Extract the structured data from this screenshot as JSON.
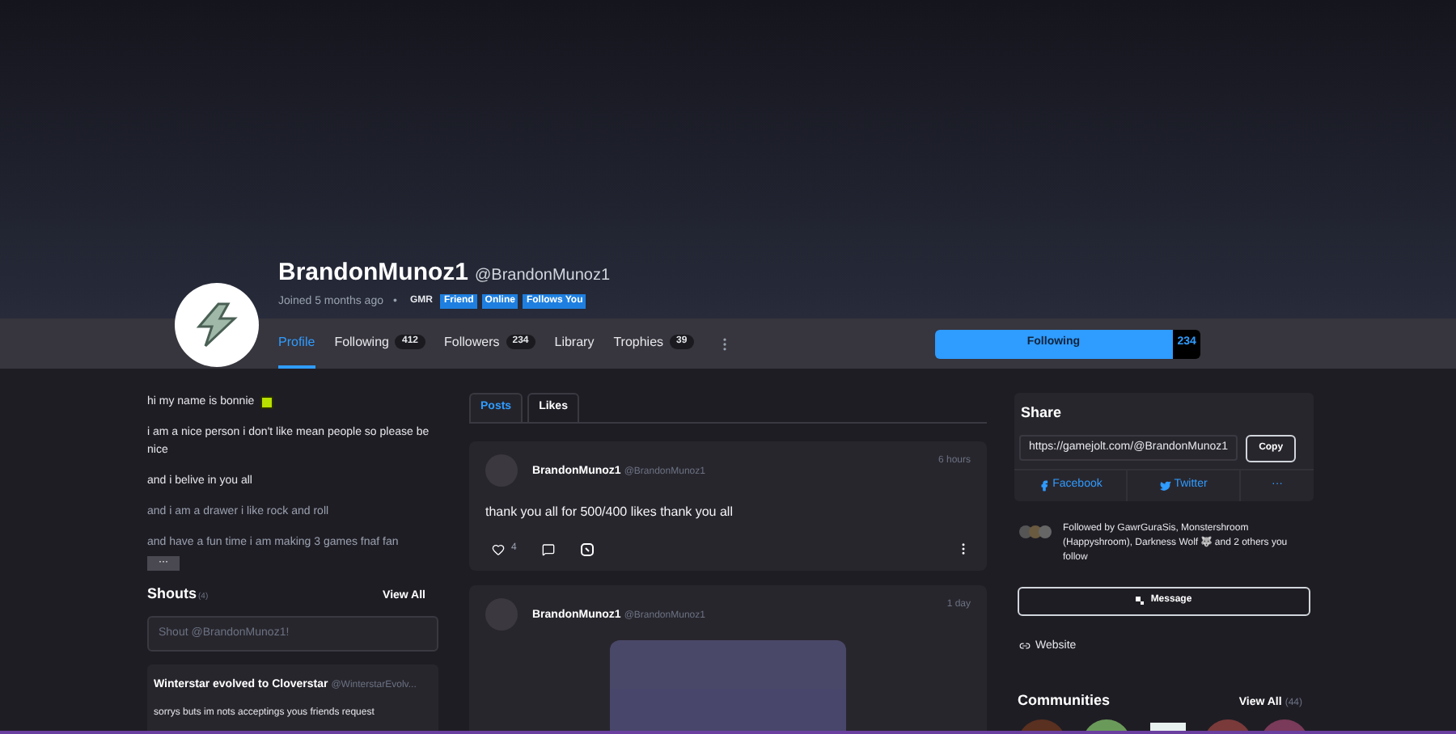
{
  "profile": {
    "display_name": "BrandonMunoz1",
    "username": "@BrandonMunoz1",
    "joined": "Joined 5 months ago",
    "separator": "•",
    "badges": [
      {
        "label": "GMR",
        "kind": "plain"
      },
      {
        "label": "Friend",
        "kind": "blue"
      },
      {
        "label": "Online",
        "kind": "blue"
      },
      {
        "label": "Follows You",
        "kind": "blue"
      }
    ]
  },
  "nav": {
    "tabs": [
      {
        "label": "Profile",
        "selected": true
      },
      {
        "label": "Following",
        "count": "412",
        "selected": false
      },
      {
        "label": "Followers",
        "count": "234",
        "selected": false
      },
      {
        "label": "Library",
        "selected": false
      },
      {
        "label": "Trophies",
        "count": "39",
        "selected": false
      }
    ],
    "follow_button": {
      "label": "Following",
      "count": "234"
    }
  },
  "bio": {
    "paragraphs": [
      "hi my name is bonnie",
      "i am a nice person i don't like mean people so please be nice",
      "and i belive in you all",
      "and i am a drawer i like rock and roll",
      "and have a fun time i am making 3 games fnaf fan"
    ],
    "expand_label": "···"
  },
  "shouts": {
    "title": "Shouts",
    "count": "(4)",
    "view_all": "View All",
    "placeholder": "Shout @BrandonMunoz1!",
    "items": [
      {
        "author": "Winterstar evolved to Cloverstar",
        "handle": "@WinterstarEvolv...",
        "text": "sorrys buts im nots acceptings yous friends request"
      }
    ]
  },
  "feed": {
    "tabs": [
      {
        "label": "Posts",
        "selected": true
      },
      {
        "label": "Likes",
        "selected": false
      }
    ],
    "posts": [
      {
        "author": "BrandonMunoz1",
        "handle": "@BrandonMunoz1",
        "time": "6 hours",
        "text": "thank you all for 500/400 likes thank you all",
        "likes": "4"
      },
      {
        "author": "BrandonMunoz1",
        "handle": "@BrandonMunoz1",
        "time": "1 day",
        "kind": "picture"
      }
    ]
  },
  "share": {
    "title": "Share",
    "url": "https://gamejolt.com/@BrandonMunoz1",
    "copy": "Copy",
    "links": [
      {
        "label": "Facebook",
        "kind": "facebook"
      },
      {
        "label": "Twitter",
        "kind": "twitter"
      },
      {
        "label": "···",
        "kind": "more"
      }
    ]
  },
  "followed_by": "Followed by GawrGuraSis, Monstershroom (Happyshroom), Darkness Wolf 🐺 and 2 others you follow",
  "message_button": "Message",
  "website_link": "Website",
  "communities": {
    "title": "Communities",
    "view_all": "View All",
    "count": "(44)"
  }
}
